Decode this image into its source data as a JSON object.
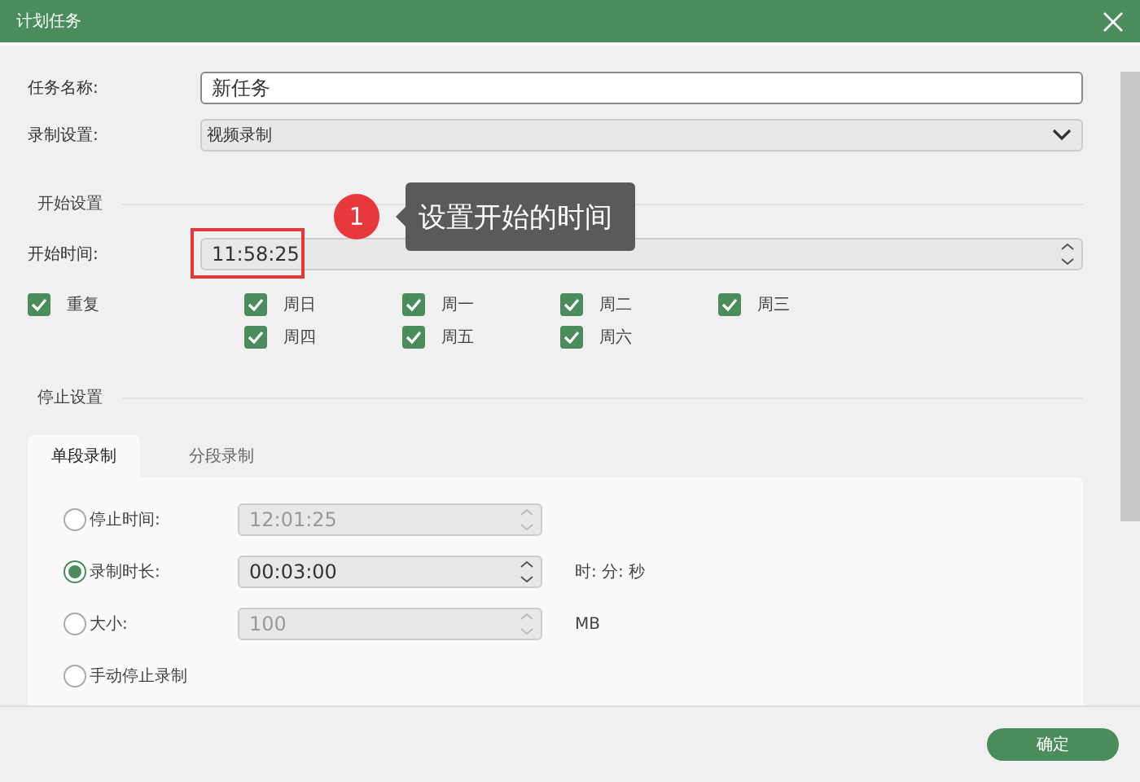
{
  "window": {
    "title": "计划任务"
  },
  "form": {
    "task_name": {
      "label": "任务名称:",
      "value": "新任务"
    },
    "record_setting": {
      "label": "录制设置:",
      "value": "视频录制"
    }
  },
  "start": {
    "section": "开始设置",
    "time": {
      "label": "开始时间:",
      "value": "11:58:25",
      "highlighted": true
    },
    "repeat": {
      "label": "重复",
      "checked": true
    },
    "days": [
      {
        "label": "周日",
        "checked": true
      },
      {
        "label": "周一",
        "checked": true
      },
      {
        "label": "周二",
        "checked": true
      },
      {
        "label": "周三",
        "checked": true
      },
      {
        "label": "周四",
        "checked": true
      },
      {
        "label": "周五",
        "checked": true
      },
      {
        "label": "周六",
        "checked": true
      }
    ]
  },
  "callout": {
    "number": "1",
    "text": "设置开始的时间"
  },
  "stop": {
    "section": "停止设置",
    "tabs": [
      {
        "label": "单段录制",
        "selected": true
      },
      {
        "label": "分段录制",
        "selected": false
      }
    ],
    "options": [
      {
        "label": "停止时间:",
        "selected": false,
        "value": "12:01:25",
        "disabled": true
      },
      {
        "label": "录制时长:",
        "selected": true,
        "value": "00:03:00",
        "disabled": false,
        "unit": "时: 分: 秒"
      },
      {
        "label": "大小:",
        "selected": false,
        "value": "100",
        "disabled": true,
        "unit": "MB"
      },
      {
        "label": "手动停止录制",
        "selected": false
      }
    ]
  },
  "footer": {
    "ok": "确定"
  }
}
